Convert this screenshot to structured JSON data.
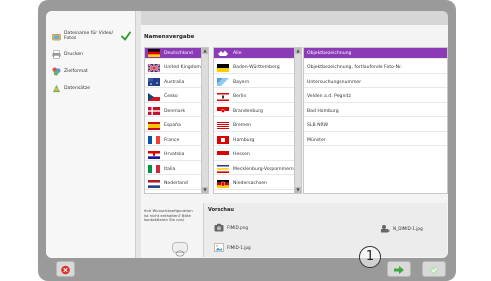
{
  "sidebar": {
    "items": [
      {
        "label": "Dateiname für Video/ Fotos",
        "icon": "folder-image-icon",
        "checked": true
      },
      {
        "label": "Drucken",
        "icon": "printer-icon"
      },
      {
        "label": "Zielformat",
        "icon": "format-icon"
      },
      {
        "label": "Datensätze",
        "icon": "records-icon"
      }
    ]
  },
  "main": {
    "title": "Namensvergabe"
  },
  "countries": [
    {
      "label": "Deutschland",
      "selected": true,
      "flag": "de"
    },
    {
      "label": "United Kingdom",
      "flag": "uk"
    },
    {
      "label": "Australia",
      "flag": "au"
    },
    {
      "label": "Česko",
      "flag": "cz"
    },
    {
      "label": "Denmark",
      "flag": "dk"
    },
    {
      "label": "España",
      "flag": "es"
    },
    {
      "label": "France",
      "flag": "fr"
    },
    {
      "label": "Hrvatska",
      "flag": "hr"
    },
    {
      "label": "Italia",
      "flag": "it"
    },
    {
      "label": "Nederland",
      "flag": "nl"
    }
  ],
  "states": [
    {
      "label": "Alle",
      "selected": true,
      "flag": "all"
    },
    {
      "label": "Baden-Württemberg",
      "flag": "bw"
    },
    {
      "label": "Bayern",
      "flag": "by"
    },
    {
      "label": "Berlin",
      "flag": "be"
    },
    {
      "label": "Brandenburg",
      "flag": "bb"
    },
    {
      "label": "Bremen",
      "flag": "hb"
    },
    {
      "label": "Hamburg",
      "flag": "hh"
    },
    {
      "label": "Hessen",
      "flag": "he"
    },
    {
      "label": "Mecklenburg-Vorpommern",
      "flag": "mv"
    },
    {
      "label": "Niedersachsen",
      "flag": "ni"
    }
  ],
  "names": [
    {
      "label": "Objektbezeichnung",
      "selected": true
    },
    {
      "label": "Objektbezeichnung, fortlaufende Foto-Nr."
    },
    {
      "label": "Untersuchungsnummer"
    },
    {
      "label": "Velden a.d. Pegnitz"
    },
    {
      "label": "Bad Homburg"
    },
    {
      "label": "SLB NRW"
    },
    {
      "label": "Münster"
    }
  ],
  "info": {
    "text": "Ihre Wunschkonfiguration ist nicht enthalten? Bitte kontaktieren Sie uns!"
  },
  "preview": {
    "title": "Vorschau",
    "items": [
      {
        "label": "FIMID.png",
        "icon": "camera-file-icon"
      },
      {
        "label": "FIMID-1.jpg",
        "icon": "image-file-icon"
      },
      {
        "label": "N_DIMID-1.jpg",
        "icon": "video-file-icon"
      }
    ]
  },
  "footer": {
    "step_number": "1"
  },
  "colors": {
    "accent": "#8a3bb5",
    "frame": "#9a9a9a",
    "check": "#2e9a2e",
    "cancel": "#d9342b",
    "next": "#3ea93e"
  }
}
